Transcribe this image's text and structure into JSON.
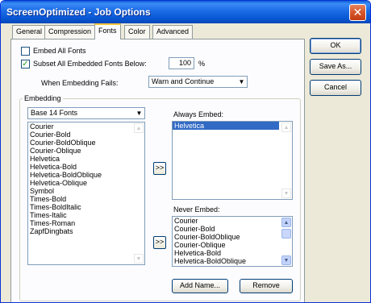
{
  "window": {
    "title": "ScreenOptimized - Job Options",
    "close_glyph": "✕"
  },
  "tabs": [
    {
      "label": "General"
    },
    {
      "label": "Compression"
    },
    {
      "label": "Fonts"
    },
    {
      "label": "Color"
    },
    {
      "label": "Advanced"
    }
  ],
  "active_tab": "Fonts",
  "fonts": {
    "embed_all": {
      "label": "Embed All Fonts",
      "checked": false
    },
    "subset": {
      "label": "Subset All Embedded Fonts Below:",
      "checked": true,
      "value": "100",
      "unit": "%"
    },
    "when_fails": {
      "label": "When Embedding Fails:",
      "value": "Warn and Continue"
    },
    "embedding_group": {
      "title": "Embedding",
      "source_select": "Base 14 Fonts",
      "source_list": [
        "Courier",
        "Courier-Bold",
        "Courier-BoldOblique",
        "Courier-Oblique",
        "Helvetica",
        "Helvetica-Bold",
        "Helvetica-BoldOblique",
        "Helvetica-Oblique",
        "Symbol",
        "Times-Bold",
        "Times-BoldItalic",
        "Times-Italic",
        "Times-Roman",
        "ZapfDingbats"
      ],
      "add_always_glyph": ">>",
      "add_never_glyph": ">>",
      "always_embed": {
        "label": "Always Embed:",
        "items": [
          "Helvetica"
        ],
        "selected": "Helvetica"
      },
      "never_embed": {
        "label": "Never Embed:",
        "items": [
          "Courier",
          "Courier-Bold",
          "Courier-BoldOblique",
          "Courier-Oblique",
          "Helvetica-Bold",
          "Helvetica-BoldOblique"
        ]
      },
      "add_name_button": "Add Name...",
      "remove_button": "Remove"
    }
  },
  "side_buttons": {
    "ok": "OK",
    "save_as": "Save As...",
    "cancel": "Cancel"
  },
  "icons": {
    "dropdown": "▼",
    "scroll_up": "▲",
    "scroll_down": "▼",
    "check": "✓"
  },
  "colors": {
    "titlebar": "#0a58d6",
    "selection": "#316ac5",
    "dialog_bg": "#ece9d8"
  }
}
